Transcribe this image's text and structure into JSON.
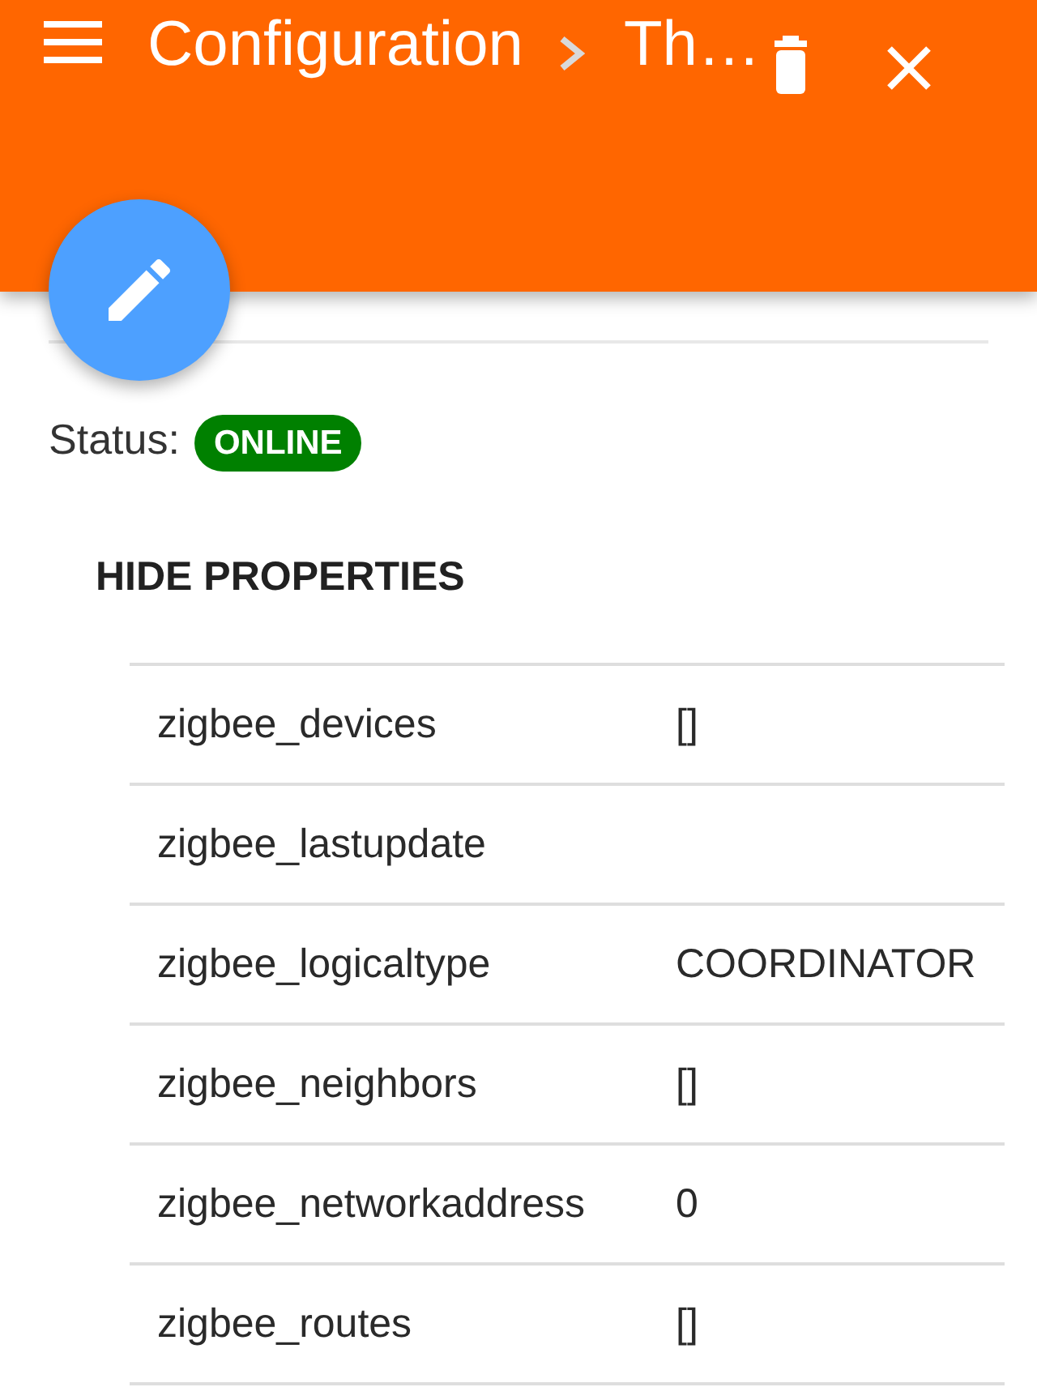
{
  "breadcrumb": [
    {
      "label": "Configuration"
    },
    {
      "label": "Th…"
    }
  ],
  "status": {
    "label": "Status:",
    "badge": "ONLINE",
    "online": true
  },
  "properties_toggle": {
    "label": "HIDE PROPERTIES"
  },
  "properties": [
    {
      "name": "zigbee_devices",
      "value": "[]"
    },
    {
      "name": "zigbee_lastupdate"
    },
    {
      "name": "zigbee_logicaltype",
      "value": "COORDINATOR"
    },
    {
      "name": "zigbee_neighbors",
      "value": "[]"
    },
    {
      "name": "zigbee_networkaddress",
      "value": "0"
    },
    {
      "name": "zigbee_routes",
      "value": "[]"
    }
  ]
}
